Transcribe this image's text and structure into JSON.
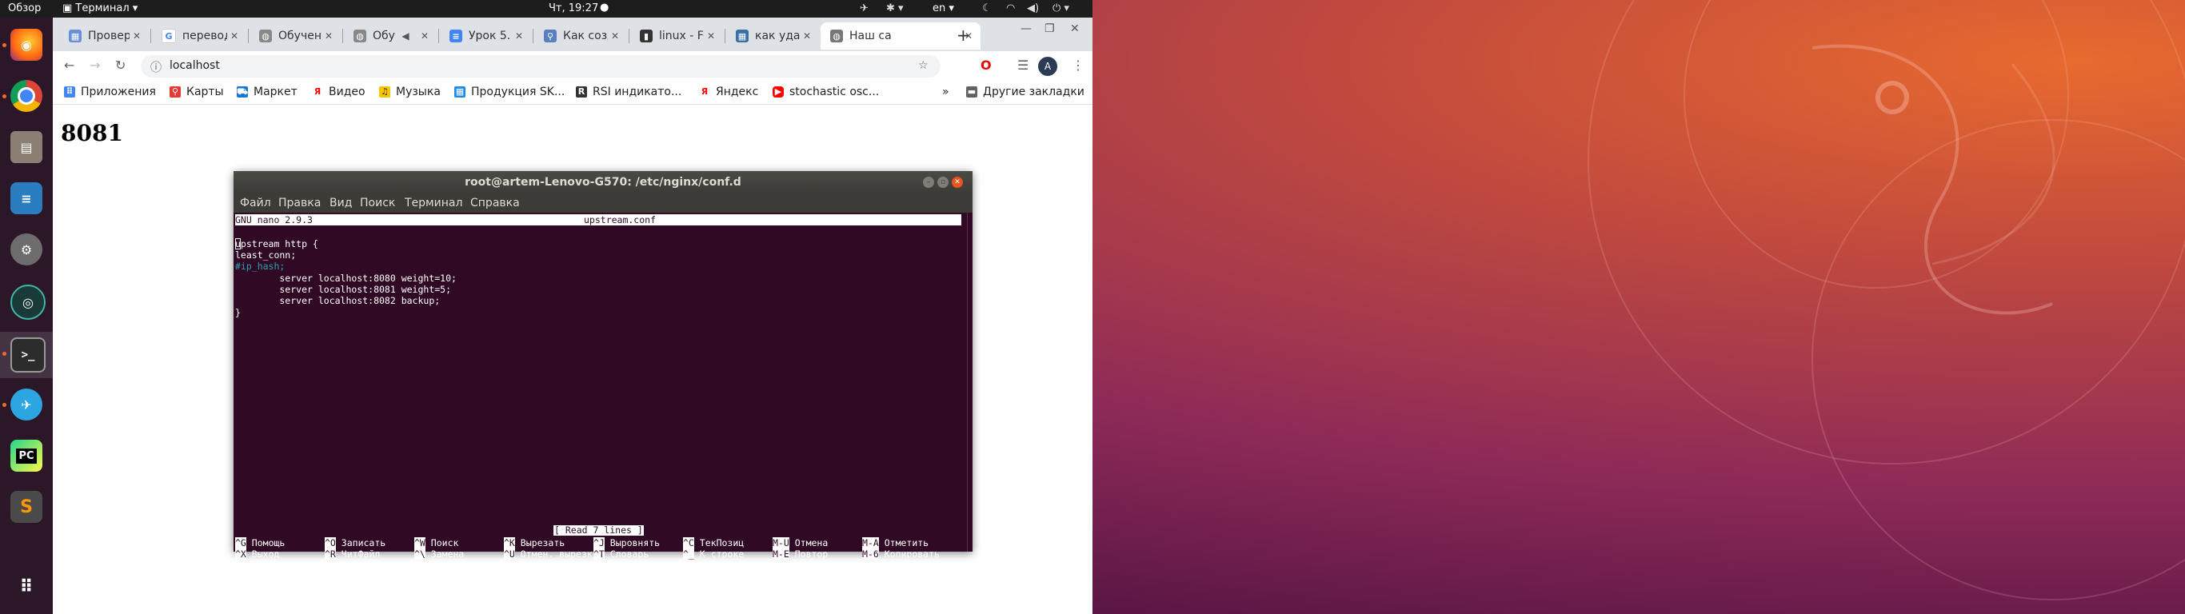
{
  "topbar": {
    "activities": "Обзор",
    "app_menu": "Терминал",
    "clock": "Чт, 19:27",
    "lang": "en"
  },
  "dock": {
    "items": [
      {
        "icon": "firefox-icon"
      },
      {
        "icon": "chrome-icon"
      },
      {
        "icon": "files-icon"
      },
      {
        "icon": "writer-icon"
      },
      {
        "icon": "settings-icon"
      },
      {
        "icon": "gitkraken-icon"
      },
      {
        "icon": "terminal-icon"
      },
      {
        "icon": "telegram-icon"
      },
      {
        "icon": "pycharm-icon"
      },
      {
        "icon": "sublime-icon"
      },
      {
        "icon": "app-grid-icon"
      }
    ]
  },
  "browser": {
    "tabs": [
      {
        "label": "Провер",
        "icon": "tab-favicon-icon"
      },
      {
        "label": "перевод",
        "icon": "google-icon"
      },
      {
        "label": "Обучен",
        "icon": "globe-icon"
      },
      {
        "label": "Обу",
        "icon": "globe-icon"
      },
      {
        "label": "Урок 5.",
        "icon": "docs-icon"
      },
      {
        "label": "Как созд",
        "icon": "link-icon"
      },
      {
        "label": "linux - Fe",
        "icon": "terminal-tab-icon"
      },
      {
        "label": "как уда",
        "icon": "tab-favicon-icon"
      },
      {
        "label": "Наш са",
        "icon": "globe-icon"
      }
    ],
    "address": "localhost",
    "bookmarks": [
      "Приложения",
      "Карты",
      "Маркет",
      "Видео",
      "Музыка",
      "Продукция SK...",
      "RSI индикато...",
      "Яндекс",
      "stochastic osc..."
    ],
    "bookmarks_more": "»",
    "other_bookmarks": "Другие закладки",
    "profile_initial": "A",
    "page_heading": "8081"
  },
  "terminal": {
    "title": "root@artem-Lenovo-G570: /etc/nginx/conf.d",
    "menu": [
      "Файл",
      "Правка",
      "Вид",
      "Поиск",
      "Терминал",
      "Справка"
    ],
    "nano_version": "  GNU nano 2.9.3",
    "file_name": "upstream.conf",
    "lines": [
      "upstream http {",
      "least_conn;",
      "#ip_hash;",
      "        server localhost:8080 weight=10;",
      "        server localhost:8081 weight=5;",
      "        server localhost:8082 backup;",
      "}"
    ],
    "status": "[ Read 7 lines ]",
    "shortcuts_row1": [
      {
        "key": "^G",
        "label": "Помощь"
      },
      {
        "key": "^O",
        "label": "Записать"
      },
      {
        "key": "^W",
        "label": "Поиск"
      },
      {
        "key": "^K",
        "label": "Вырезать"
      },
      {
        "key": "^J",
        "label": "Выровнять"
      },
      {
        "key": "^C",
        "label": "ТекПозиц"
      },
      {
        "key": "M-U",
        "label": "Отмена"
      },
      {
        "key": "M-A",
        "label": "Отметить"
      }
    ],
    "shortcuts_row2": [
      {
        "key": "^X",
        "label": "Выход"
      },
      {
        "key": "^R",
        "label": "ЧитФайл"
      },
      {
        "key": "^\\",
        "label": "Замена"
      },
      {
        "key": "^U",
        "label": "Отмен. вырезк"
      },
      {
        "key": "^T",
        "label": "Словарь"
      },
      {
        "key": "^_",
        "label": "К строке"
      },
      {
        "key": "M-E",
        "label": "Повтор"
      },
      {
        "key": "M-6",
        "label": "Копировать"
      }
    ]
  },
  "colors": {
    "terminal_bg": "#300a24",
    "dock_bg": "#2b1728",
    "accent_orange": "#e95420",
    "comment": "#2aa1b3"
  }
}
